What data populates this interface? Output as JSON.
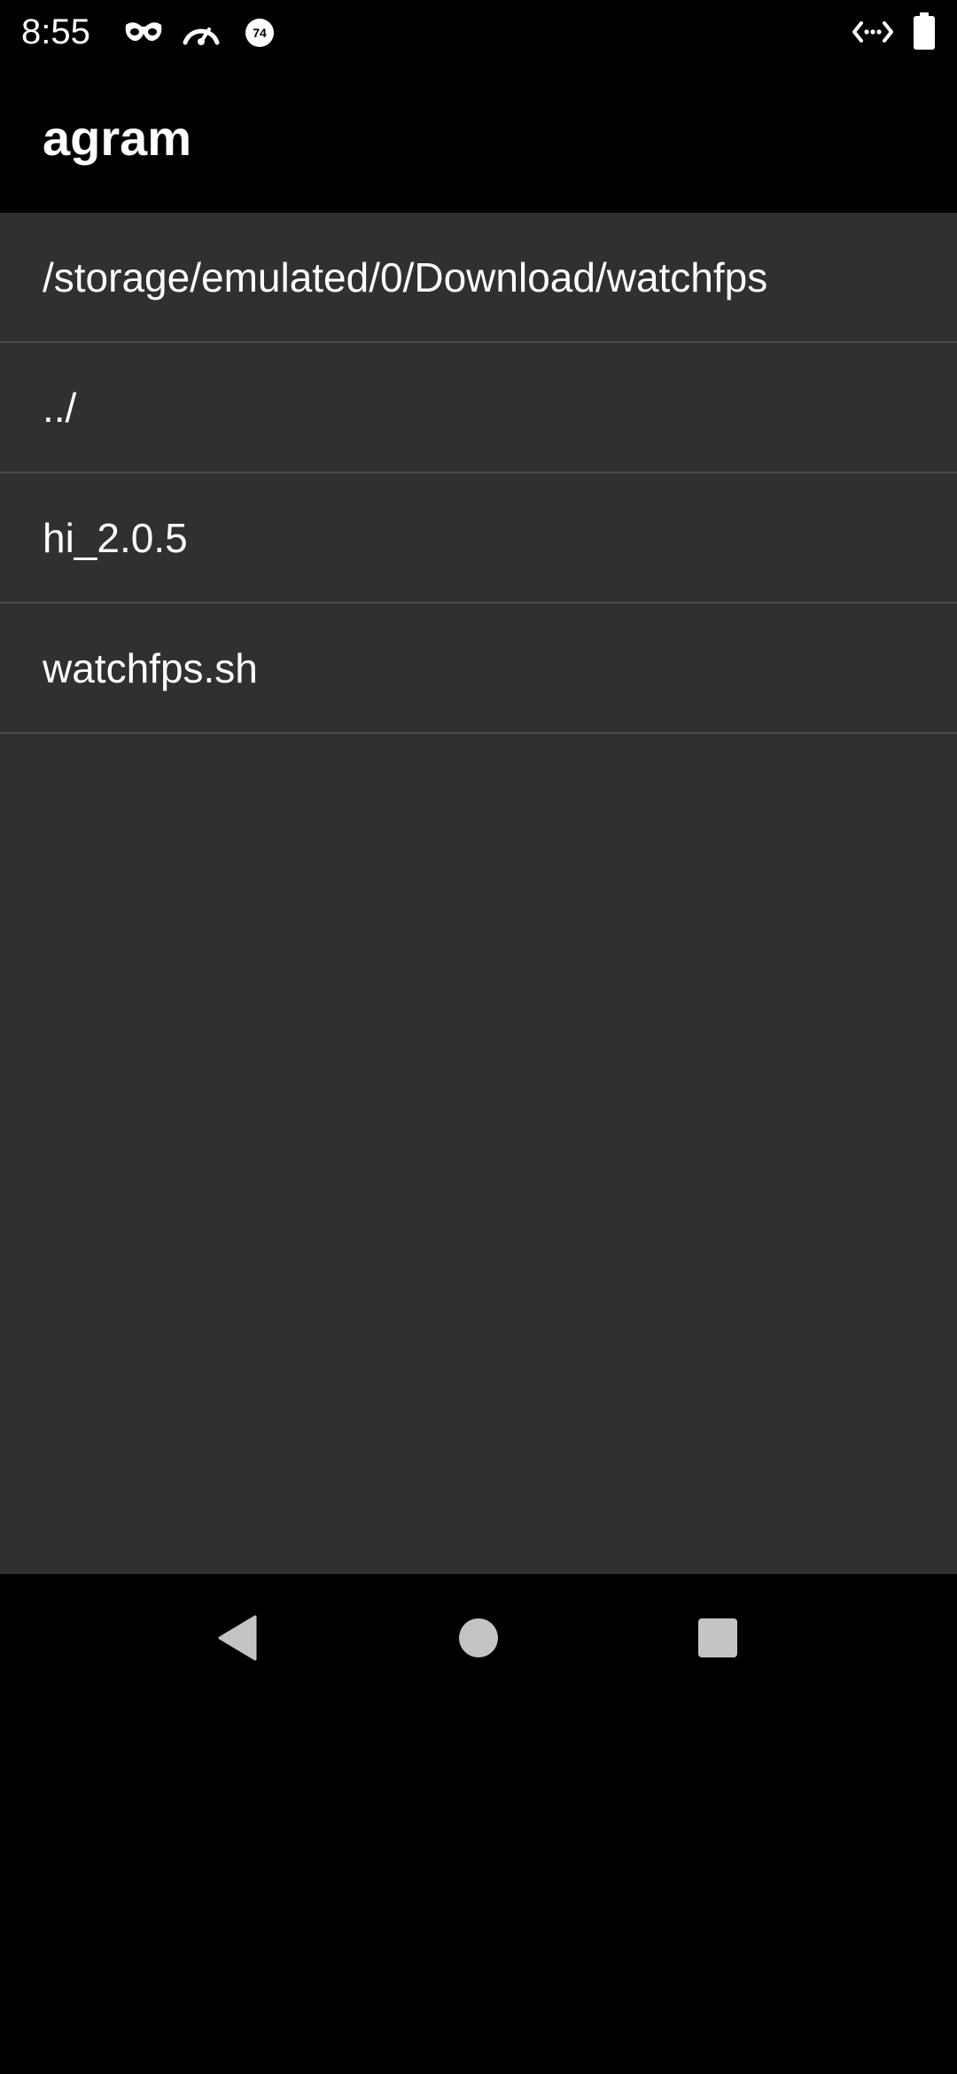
{
  "status_bar": {
    "time": "8:55",
    "notification_icons": [
      "incognito-mask-icon",
      "speedometer-icon",
      "badge-74-icon"
    ],
    "badge_number": "74",
    "right_icons": [
      "code-arrows-icon",
      "battery-icon"
    ]
  },
  "app_bar": {
    "title": "agram"
  },
  "file_list": {
    "rows": [
      {
        "label": "/storage/emulated/0/Download/watchfps"
      },
      {
        "label": "../"
      },
      {
        "label": "hi_2.0.5"
      },
      {
        "label": "watchfps.sh"
      }
    ]
  },
  "nav_bar": {
    "buttons": [
      "back-icon",
      "home-icon",
      "recents-icon"
    ]
  },
  "colors": {
    "background": "#000000",
    "list_background": "#303030",
    "divider": "#4a4a4a",
    "text": "#ffffff",
    "nav_icon": "#c4c4c4"
  }
}
